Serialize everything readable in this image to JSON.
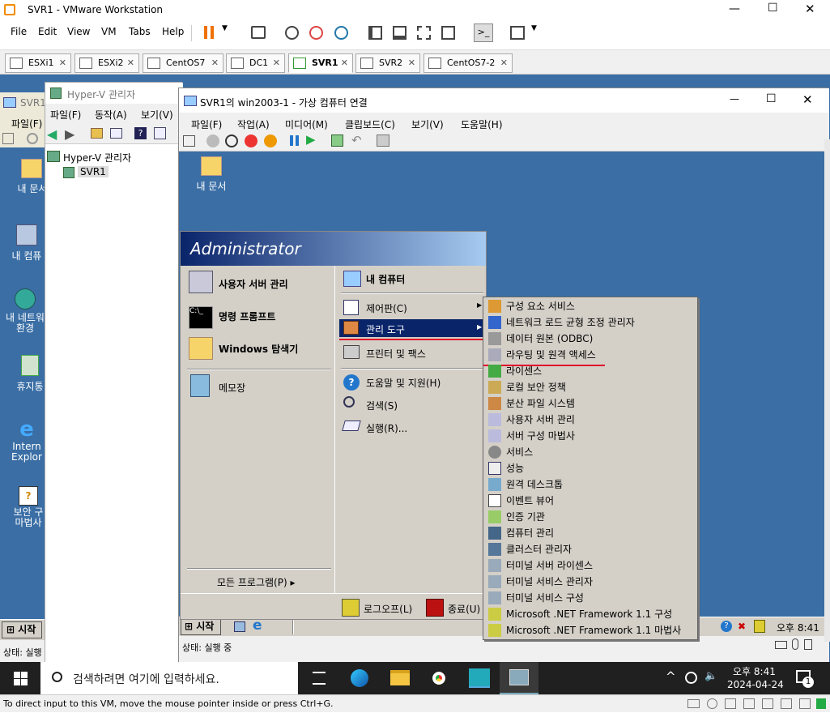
{
  "vmware": {
    "title": "SVR1 - VMware Workstation",
    "menu": [
      "File",
      "Edit",
      "View",
      "VM",
      "Tabs",
      "Help"
    ],
    "tabs": [
      {
        "label": "ESXi1"
      },
      {
        "label": "ESXi2"
      },
      {
        "label": "CentOS7"
      },
      {
        "label": "DC1"
      },
      {
        "label": "SVR1",
        "active": true
      },
      {
        "label": "SVR2"
      },
      {
        "label": "CentOS7-2"
      }
    ],
    "status_hint": "To direct input to this VM, move the mouse pointer inside or press Ctrl+G."
  },
  "hyperv": {
    "title": "Hyper-V 관리자",
    "menu": [
      "파일(F)",
      "동작(A)",
      "보기(V)"
    ],
    "tree_root": "Hyper-V 관리자",
    "tree_child": "SVR1",
    "left_partial_title": "SVR1",
    "left_partial_menu": "파일(F)",
    "status_partial": "상태: 실행"
  },
  "vmconnect": {
    "title": "SVR1의 win2003-1 - 가상 컴퓨터 연결",
    "menu": [
      "파일(F)",
      "작업(A)",
      "미디어(M)",
      "클립보드(C)",
      "보기(V)",
      "도움말(H)"
    ],
    "status": "상태: 실행 중"
  },
  "desktop_icons": [
    {
      "label": "내 문서"
    },
    {
      "label": "내 문서"
    },
    {
      "label": "내 컴퓨"
    },
    {
      "label": "내 네트워\n환경"
    },
    {
      "label": "휴지통"
    },
    {
      "label": "Intern\nExplor"
    },
    {
      "label": "보안 구\n마법사"
    }
  ],
  "start_menu": {
    "user": "Administrator",
    "left_items": [
      "사용자 서버 관리",
      "명령 프롬프트",
      "Windows 탐색기",
      "메모장"
    ],
    "all_programs": "모든 프로그램(P)",
    "right_items": [
      "내 컴퓨터",
      "제어판(C)",
      "관리 도구",
      "프린터 및 팩스",
      "도움말 및 지원(H)",
      "검색(S)",
      "실행(R)..."
    ],
    "logoff": "로그오프(L)",
    "shutdown": "종료(U)"
  },
  "admin_tools": [
    "구성 요소 서비스",
    "네트워크 로드 균형 조정 관리자",
    "데이터 원본 (ODBC)",
    "라우팅 및 원격 액세스",
    "라이센스",
    "로컬 보안 정책",
    "분산 파일 시스템",
    "사용자 서버 관리",
    "서버 구성 마법사",
    "서비스",
    "성능",
    "원격 데스크톱",
    "이벤트 뷰어",
    "인증 기관",
    "컴퓨터 관리",
    "클러스터 관리자",
    "터미널 서버 라이센스",
    "터미널 서비스 관리자",
    "터미널 서비스 구성",
    "Microsoft .NET Framework 1.1 구성",
    "Microsoft .NET Framework 1.1 마법사"
  ],
  "guest_taskbar": {
    "start": "시작",
    "clock": "오후 8:41"
  },
  "host_taskbar": {
    "search_placeholder": "검색하려면 여기에 입력하세요.",
    "time": "오후 8:41",
    "date": "2024-04-24",
    "notif_count": "1"
  },
  "colors": {
    "guest_desktop": "#3a6ea5",
    "highlight": "#0a246a",
    "red_underline": "#e0102a"
  }
}
